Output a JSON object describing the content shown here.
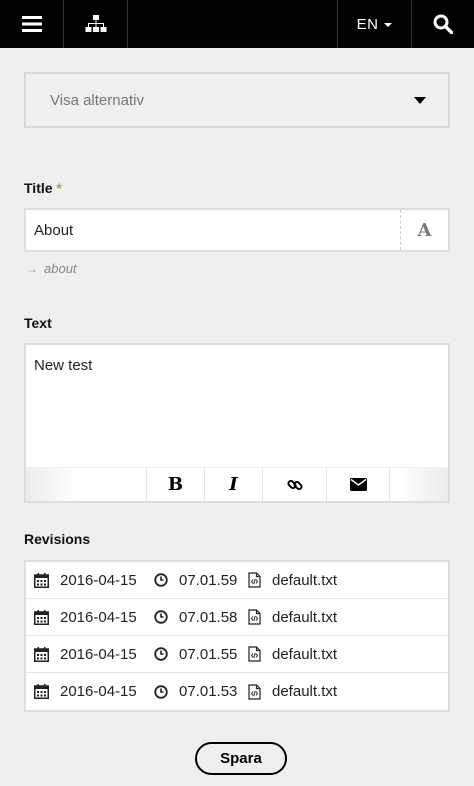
{
  "topbar": {
    "menu_icon": "hamburger-menu-icon",
    "sitemap_icon": "sitemap-icon",
    "language": "EN",
    "search_icon": "search-icon",
    "background": "#000000"
  },
  "options_select": {
    "placeholder": "Visa alternativ"
  },
  "title_field": {
    "label": "Title",
    "required_marker": "*",
    "value": "About",
    "slug": "about",
    "required_color": "#8fb14a"
  },
  "text_field": {
    "label": "Text",
    "value": "New test",
    "toolbar": {
      "bold_label": "B",
      "italic_label": "I",
      "link_icon": "link-icon",
      "email_icon": "envelope-icon"
    }
  },
  "revisions": {
    "label": "Revisions",
    "items": [
      {
        "date": "2016-04-15",
        "time": "07.01.59",
        "file": "default.txt"
      },
      {
        "date": "2016-04-15",
        "time": "07.01.58",
        "file": "default.txt"
      },
      {
        "date": "2016-04-15",
        "time": "07.01.55",
        "file": "default.txt"
      },
      {
        "date": "2016-04-15",
        "time": "07.01.53",
        "file": "default.txt"
      }
    ]
  },
  "save_button": {
    "label": "Spara"
  }
}
